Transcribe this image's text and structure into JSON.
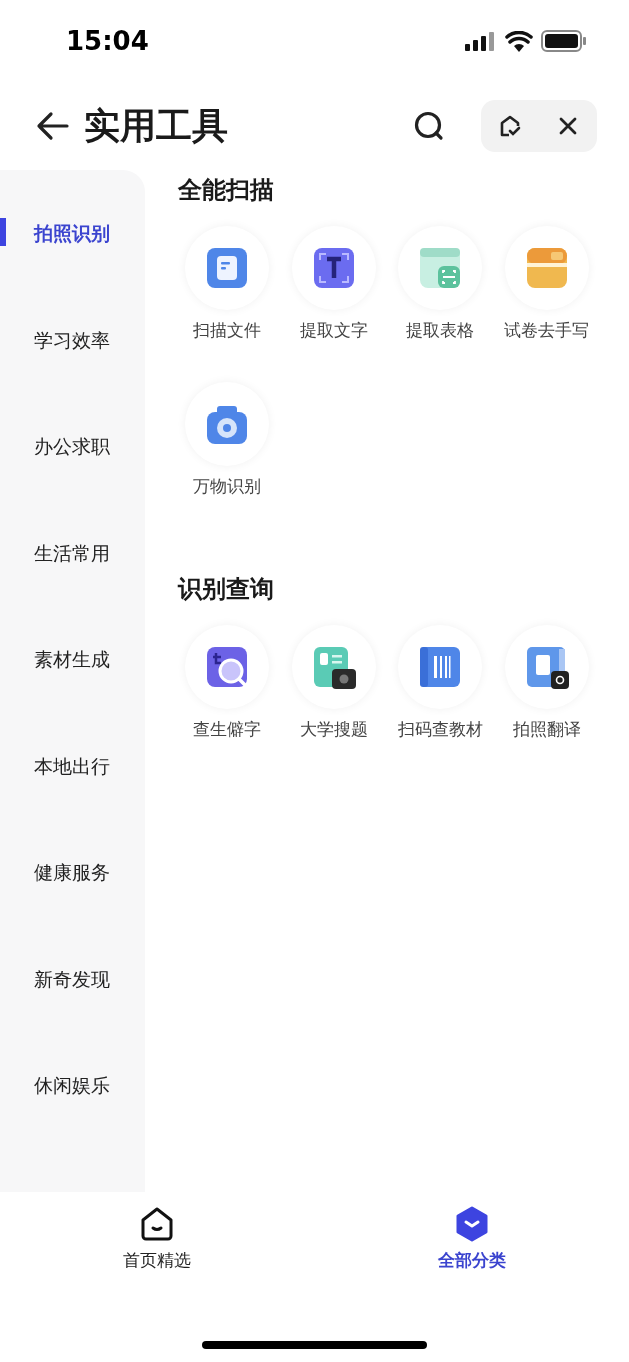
{
  "status_bar": {
    "time": "15:04"
  },
  "header": {
    "title": "实用工具"
  },
  "sidebar": {
    "items": [
      {
        "label": "拍照识别",
        "selected": true
      },
      {
        "label": "学习效率",
        "selected": false
      },
      {
        "label": "办公求职",
        "selected": false
      },
      {
        "label": "生活常用",
        "selected": false
      },
      {
        "label": "素材生成",
        "selected": false
      },
      {
        "label": "本地出行",
        "selected": false
      },
      {
        "label": "健康服务",
        "selected": false
      },
      {
        "label": "新奇发现",
        "selected": false
      },
      {
        "label": "休闲娱乐",
        "selected": false
      }
    ]
  },
  "sections": [
    {
      "title": "全能扫描",
      "tools": [
        {
          "label": "扫描文件"
        },
        {
          "label": "提取文字"
        },
        {
          "label": "提取表格"
        },
        {
          "label": "试卷去手写"
        },
        {
          "label": "万物识别"
        }
      ]
    },
    {
      "title": "识别查询",
      "tools": [
        {
          "label": "查生僻字"
        },
        {
          "label": "大学搜题"
        },
        {
          "label": "扫码查教材"
        },
        {
          "label": "拍照翻译"
        }
      ]
    }
  ],
  "tab_bar": {
    "tabs": [
      {
        "label": "首页精选",
        "selected": false
      },
      {
        "label": "全部分类",
        "selected": true
      }
    ]
  }
}
